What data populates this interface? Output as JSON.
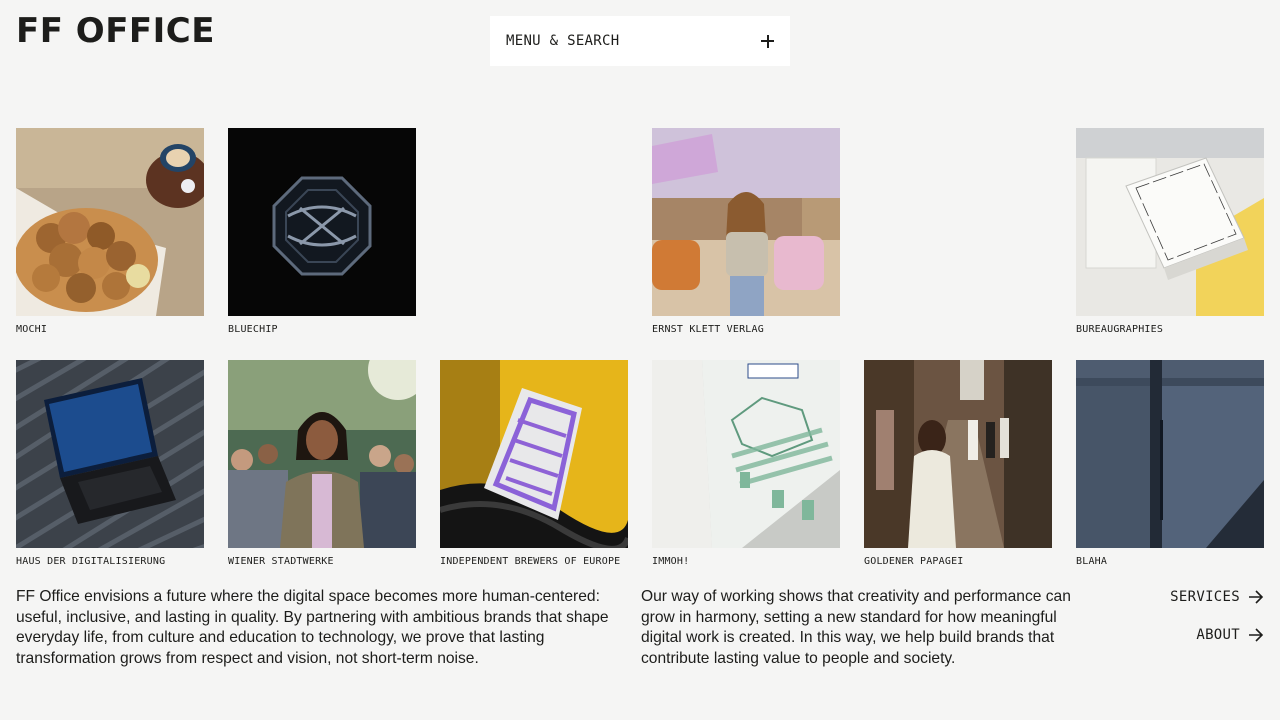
{
  "brand": {
    "logo_text": "FF OFFICE"
  },
  "header": {
    "menu_search_label": "MENU & SEARCH"
  },
  "projects": [
    {
      "label": "MOCHI"
    },
    {
      "label": "BLUECHIP"
    },
    {
      "label": "ERNST KLETT VERLAG"
    },
    {
      "label": "BUREAUGRAPHIES"
    },
    {
      "label": "HAUS DER DIGITALISIERUNG"
    },
    {
      "label": "WIENER STADTWERKE"
    },
    {
      "label": "INDEPENDENT BREWERS OF EUROPE"
    },
    {
      "label": "IMMOH!"
    },
    {
      "label": "GOLDENER PAPAGEI"
    },
    {
      "label": "BLAHA"
    }
  ],
  "intro": {
    "left": "FF Office envisions a future where the digital space becomes more human-centered: useful, inclusive, and lasting in quality. By partnering with ambitious brands that shape everyday life, from culture and education to technology, we prove that lasting transformation grows from respect and vision, not short-term noise.",
    "right": "Our way of working shows that creativity and performance can grow in harmony, setting a new standard for how meaningful digital work is created. In this way, we help build brands that contribute lasting value to people and society."
  },
  "links": {
    "services": "SERVICES",
    "about": "ABOUT"
  }
}
